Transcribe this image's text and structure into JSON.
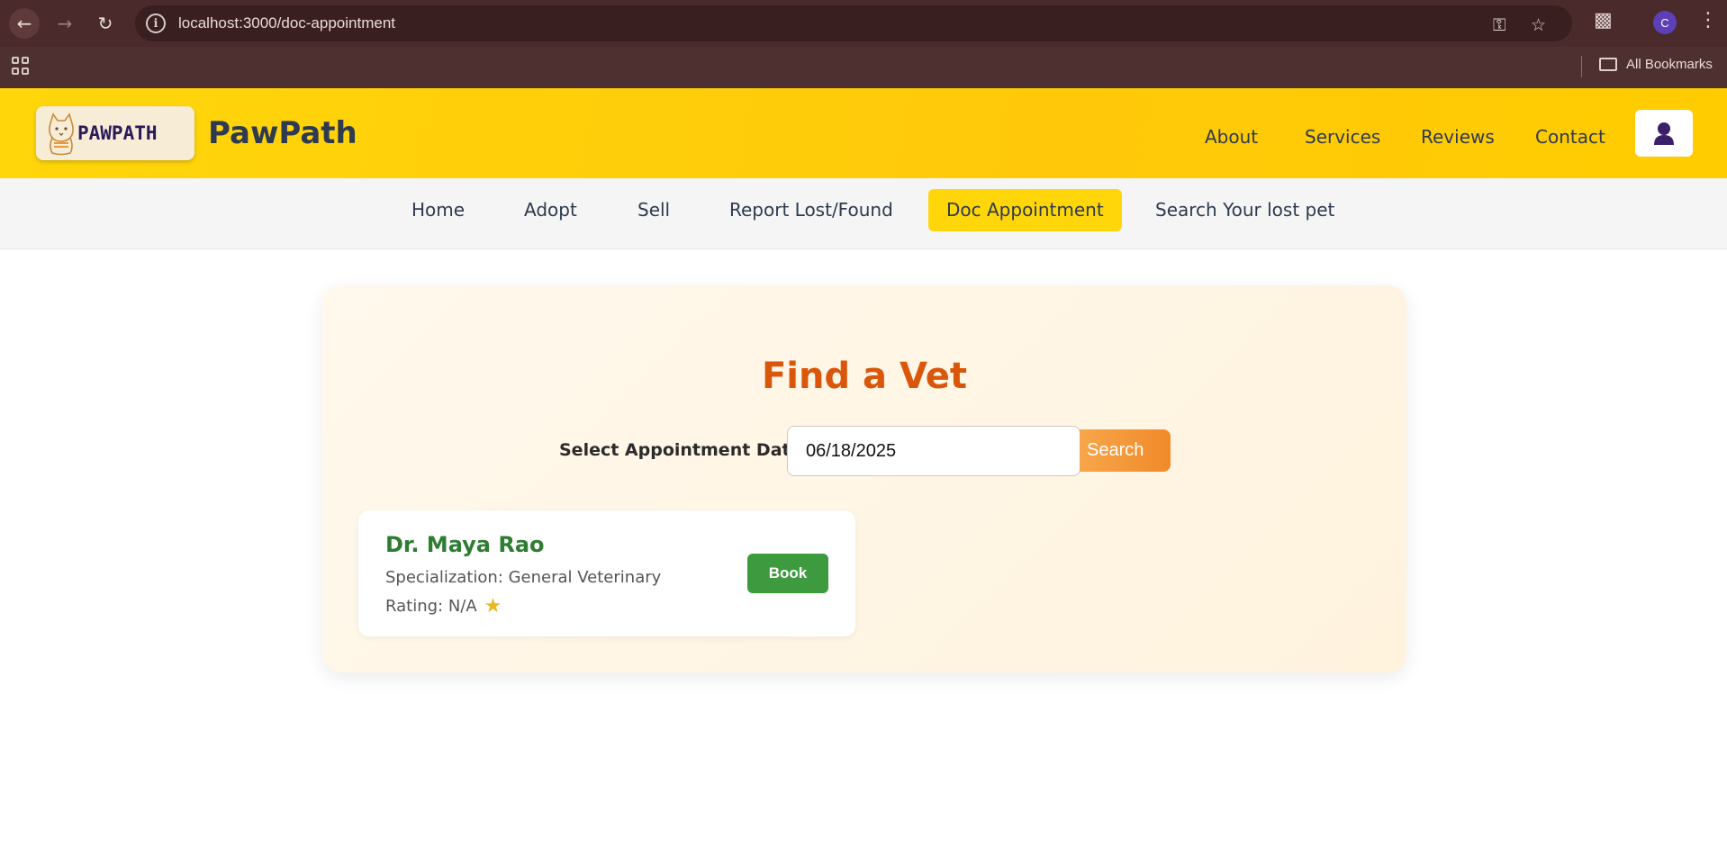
{
  "browser": {
    "url": "localhost:3000/doc-appointment",
    "profile_initial": "C",
    "bookmarks_label": "All Bookmarks"
  },
  "site": {
    "logo_text": "PAWPATH",
    "title": "PawPath",
    "header_links": [
      "About",
      "Services",
      "Reviews",
      "Contact"
    ],
    "nav_items": [
      "Home",
      "Adopt",
      "Sell",
      "Report Lost/Found",
      "Doc Appointment",
      "Search Your lost pet"
    ],
    "active_nav": "Doc Appointment"
  },
  "main": {
    "title": "Find a Vet",
    "date_label": "Select Appointment Date:",
    "date_value": "06/18/2025",
    "search_label": "Search",
    "vets": [
      {
        "name": "Dr. Maya Rao",
        "specialization": "Specialization: General Veterinary",
        "rating": "Rating: N/A",
        "book_label": "Book"
      }
    ]
  },
  "colors": {
    "header_yellow": "#ffd60a",
    "title_orange": "#d9560a",
    "vet_green": "#2e7d32",
    "book_green": "#3d9a3f"
  }
}
